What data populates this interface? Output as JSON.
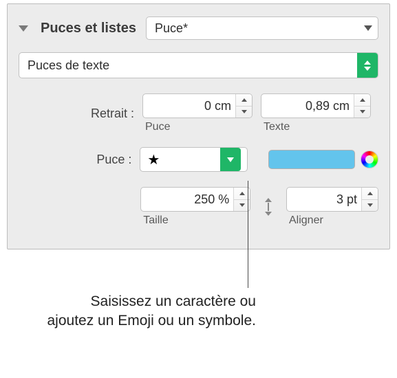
{
  "header": {
    "title": "Puces et listes",
    "style_select": "Puce*"
  },
  "bullet_type": "Puces de texte",
  "indent": {
    "label": "Retrait :",
    "puce_value": "0 cm",
    "puce_caption": "Puce",
    "texte_value": "0,89 cm",
    "texte_caption": "Texte"
  },
  "puce": {
    "label": "Puce :",
    "symbol": "★",
    "color": "#63c4ec"
  },
  "size": {
    "value": "250 %",
    "caption": "Taille"
  },
  "align": {
    "value": "3 pt",
    "caption": "Aligner"
  },
  "callout": "Saisissez un caractère ou ajoutez un Emoji ou un symbole."
}
